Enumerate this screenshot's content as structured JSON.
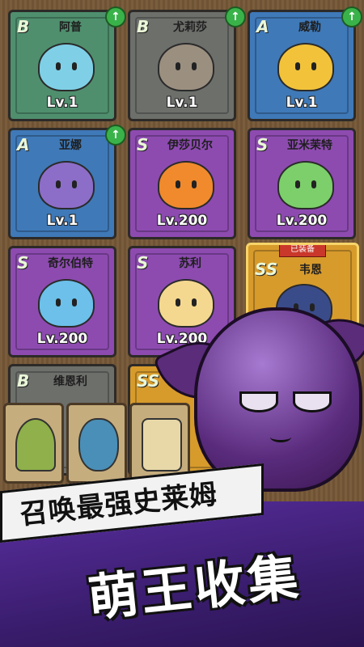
{
  "cards": [
    {
      "rank": "B",
      "name": "阿普",
      "level": "Lv.1",
      "upgrade": true,
      "color": "#4f8f6e",
      "slime": "#7fd0e6"
    },
    {
      "rank": "B",
      "name": "尤莉莎",
      "level": "Lv.1",
      "upgrade": true,
      "color": "#6d6f6b",
      "slime": "#9b8f80"
    },
    {
      "rank": "A",
      "name": "威勒",
      "level": "Lv.1",
      "upgrade": true,
      "color": "#3f79b8",
      "slime": "#f2c33a"
    },
    {
      "rank": "A",
      "name": "亚娜",
      "level": "Lv.1",
      "upgrade": true,
      "color": "#3f79b8",
      "slime": "#8c6ec8"
    },
    {
      "rank": "S",
      "name": "伊莎贝尔",
      "level": "Lv.200",
      "upgrade": false,
      "color": "#8d4bb0",
      "slime": "#f08a2c"
    },
    {
      "rank": "S",
      "name": "亚米茉特",
      "level": "Lv.200",
      "upgrade": false,
      "color": "#8d4bb0",
      "slime": "#7ccf6a"
    },
    {
      "rank": "S",
      "name": "奇尔伯特",
      "level": "Lv.200",
      "upgrade": false,
      "color": "#8d4bb0",
      "slime": "#6cc0ea"
    },
    {
      "rank": "S",
      "name": "苏利",
      "level": "Lv.200",
      "upgrade": false,
      "color": "#8d4bb0",
      "slime": "#f5d890"
    },
    {
      "rank": "SS",
      "name": "韦恩",
      "level": "",
      "upgrade": false,
      "color": "#d79b2c",
      "slime": "#3a4b8a",
      "equipped": "已装备"
    },
    {
      "rank": "B",
      "name": "维恩利",
      "level": "",
      "upgrade": false,
      "color": "#6d6f6b",
      "slime": "#999999"
    },
    {
      "rank": "SS",
      "name": "",
      "level": "",
      "upgrade": false,
      "color": "#d79b2c",
      "slime": "#cccccc"
    }
  ],
  "bottom_slots": [
    {
      "icon": "trophy-altar-icon"
    },
    {
      "icon": "rune-stone-icon"
    },
    {
      "icon": "scroll-map-icon"
    }
  ],
  "promo": {
    "line1": "召唤最强史莱姆",
    "line2": "萌王收集"
  }
}
